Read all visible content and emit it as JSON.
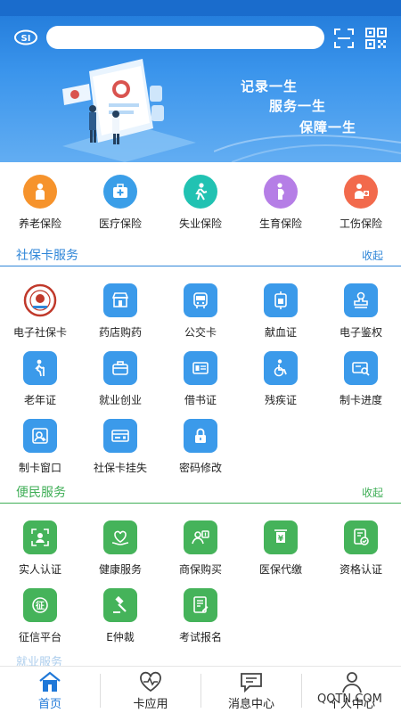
{
  "header": {
    "search_placeholder": "",
    "slogans": [
      "记录一生",
      "服务一生",
      "保障一生"
    ],
    "icons": [
      "si-logo-icon",
      "scan-icon",
      "qr-code-icon"
    ]
  },
  "insurance": [
    {
      "label": "养老保险",
      "color": "#f6932c",
      "icon": "elder-person-icon"
    },
    {
      "label": "医疗保险",
      "color": "#3a9ee8",
      "icon": "medical-kit-icon"
    },
    {
      "label": "失业保险",
      "color": "#21c2b2",
      "icon": "walking-person-icon"
    },
    {
      "label": "生育保险",
      "color": "#b57ee6",
      "icon": "pregnant-person-icon"
    },
    {
      "label": "工伤保险",
      "color": "#f26a4c",
      "icon": "injured-worker-icon"
    }
  ],
  "social_card": {
    "title": "社保卡服务",
    "toggle": "收起",
    "color": "#2f86d8",
    "items": [
      {
        "label": "电子社保卡",
        "icon": "ecard-seal-icon"
      },
      {
        "label": "药店购药",
        "icon": "pharmacy-store-icon"
      },
      {
        "label": "公交卡",
        "icon": "bus-card-icon"
      },
      {
        "label": "献血证",
        "icon": "blood-bag-icon"
      },
      {
        "label": "电子鉴权",
        "icon": "stamp-icon"
      },
      {
        "label": "老年证",
        "icon": "elder-walking-icon"
      },
      {
        "label": "就业创业",
        "icon": "briefcase-icon"
      },
      {
        "label": "借书证",
        "icon": "book-id-icon"
      },
      {
        "label": "残疾证",
        "icon": "wheelchair-icon"
      },
      {
        "label": "制卡进度",
        "icon": "card-search-icon"
      },
      {
        "label": "制卡窗口",
        "icon": "card-window-icon"
      },
      {
        "label": "社保卡挂失",
        "icon": "card-lost-icon"
      },
      {
        "label": "密码修改",
        "icon": "lock-icon"
      }
    ]
  },
  "convenience": {
    "title": "便民服务",
    "toggle": "收起",
    "color": "#3fae56",
    "items": [
      {
        "label": "实人认证",
        "icon": "face-verify-icon"
      },
      {
        "label": "健康服务",
        "icon": "health-hand-icon"
      },
      {
        "label": "商保购买",
        "icon": "commercial-insurance-icon"
      },
      {
        "label": "医保代缴",
        "icon": "medical-pay-icon"
      },
      {
        "label": "资格认证",
        "icon": "qualification-icon"
      },
      {
        "label": "征信平台",
        "icon": "credit-badge-icon"
      },
      {
        "label": "E仲裁",
        "icon": "gavel-icon"
      },
      {
        "label": "考试报名",
        "icon": "exam-form-icon"
      }
    ]
  },
  "next_section": {
    "title": "就业服务"
  },
  "tabbar": {
    "tabs": [
      {
        "label": "首页",
        "icon": "home-icon",
        "active": true
      },
      {
        "label": "卡应用",
        "icon": "heart-pulse-icon",
        "active": false
      },
      {
        "label": "消息中心",
        "icon": "message-icon",
        "active": false
      },
      {
        "label": "个人中心",
        "icon": "person-icon",
        "active": false
      }
    ],
    "active_color": "#1f78d8"
  },
  "watermark": "QQTN.COM"
}
